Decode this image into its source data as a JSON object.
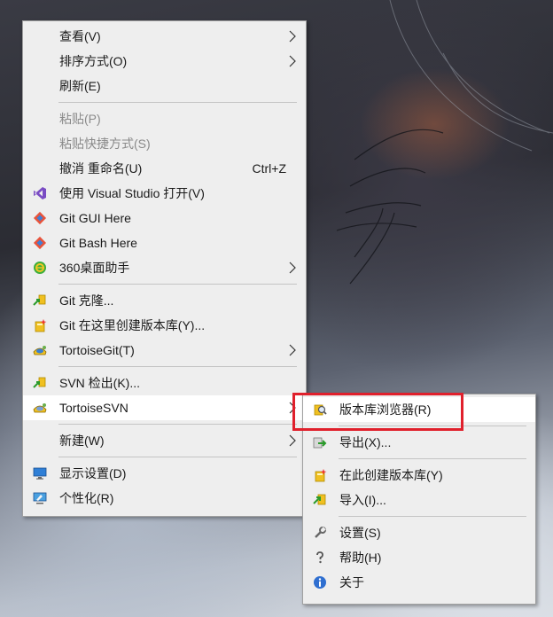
{
  "main_menu": {
    "items": [
      {
        "label": "查看(V)",
        "submenu": true
      },
      {
        "label": "排序方式(O)",
        "submenu": true
      },
      {
        "label": "刷新(E)"
      },
      {
        "label": "粘贴(P)",
        "disabled": true
      },
      {
        "label": "粘贴快捷方式(S)",
        "disabled": true
      },
      {
        "label": "撤消 重命名(U)",
        "accel": "Ctrl+Z"
      },
      {
        "label": "使用 Visual Studio 打开(V)",
        "icon": "visual-studio-icon"
      },
      {
        "label": "Git GUI Here",
        "icon": "git-icon"
      },
      {
        "label": "Git Bash Here",
        "icon": "git-icon"
      },
      {
        "label": "360桌面助手",
        "icon": "360-icon",
        "submenu": true
      },
      {
        "label": "Git 克隆...",
        "icon": "git-clone-icon"
      },
      {
        "label": "Git 在这里创建版本库(Y)...",
        "icon": "create-repo-icon"
      },
      {
        "label": "TortoiseGit(T)",
        "icon": "tortoisegit-icon",
        "submenu": true
      },
      {
        "label": "SVN 检出(K)...",
        "icon": "svn-checkout-icon"
      },
      {
        "label": "TortoiseSVN",
        "icon": "tortoisesvn-icon",
        "submenu": true,
        "active": true
      },
      {
        "label": "新建(W)",
        "submenu": true
      },
      {
        "label": "显示设置(D)",
        "icon": "display-settings-icon"
      },
      {
        "label": "个性化(R)",
        "icon": "personalize-icon"
      }
    ]
  },
  "svn_submenu": {
    "items": [
      {
        "label": "版本库浏览器(R)",
        "icon": "repo-browser-icon",
        "highlighted": true
      },
      {
        "label": "导出(X)...",
        "icon": "export-icon"
      },
      {
        "label": "在此创建版本库(Y)",
        "icon": "create-repo-here-icon"
      },
      {
        "label": "导入(I)...",
        "icon": "import-icon"
      },
      {
        "label": "设置(S)",
        "icon": "settings-wrench-icon"
      },
      {
        "label": "帮助(H)",
        "icon": "help-icon"
      },
      {
        "label": "关于",
        "icon": "info-icon"
      }
    ]
  },
  "colors": {
    "menu_bg": "#eeeeee",
    "hover_bg": "#ffffff",
    "highlight_border": "#e0202c",
    "disabled_text": "#8a8a8a"
  }
}
